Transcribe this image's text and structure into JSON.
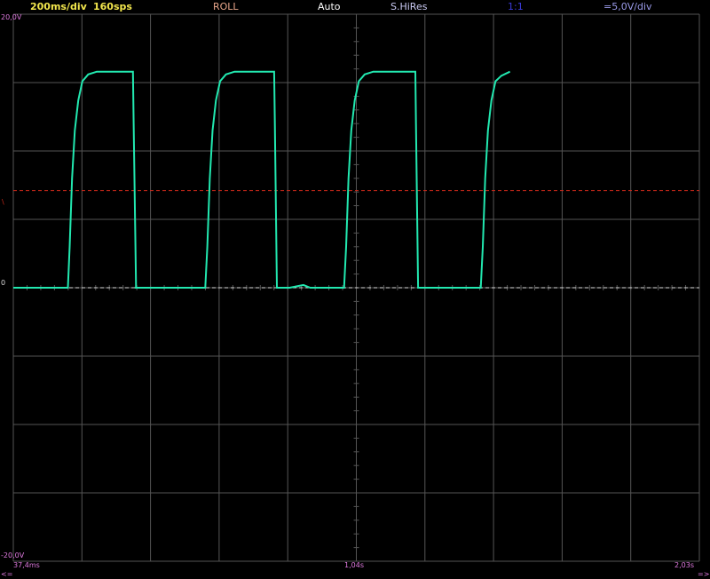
{
  "status": {
    "timebase": "200ms/div",
    "sample_rate": "160sps",
    "mode": "ROLL",
    "trigger": "Auto",
    "acquisition": "S.HiRes",
    "probe": "1:1",
    "volts_div": "=5,0V/div"
  },
  "colors": {
    "timebase": "#f2e64d",
    "mode": "#e8a68a",
    "trigger": "#ffffff",
    "acquisition": "#c9c9f2",
    "probe": "#3a3ad8",
    "volts_div": "#9a9ae8",
    "trace": "#22e8b0",
    "trigger_level_line": "#d02a1a",
    "ground_line": "#dcdcdc",
    "grid": "#555555",
    "axis_labels": "#e07ae0"
  },
  "axis_labels": {
    "y_top": "20,0V",
    "y_bottom": "-20,0V",
    "ground_marker": "0",
    "trigger_marker": "\\",
    "x_left": "37,4ms",
    "x_mid": "1,04s",
    "x_right": "2,03s",
    "left_arrow": "<=",
    "right_arrow": "=>"
  },
  "chart_data": {
    "type": "line",
    "x_unit": "s",
    "y_unit": "V",
    "xlim": [
      0.0374,
      2.03
    ],
    "ylim": [
      -20,
      20
    ],
    "grid": true,
    "divisions": {
      "x": 10,
      "y": 8
    },
    "trigger_level": 7.1,
    "ground_level": 0,
    "series": [
      {
        "points": [
          [
            0.0374,
            0
          ],
          [
            0.15,
            0
          ],
          [
            0.196,
            0
          ],
          [
            0.201,
            3.0
          ],
          [
            0.208,
            8.0
          ],
          [
            0.216,
            11.5
          ],
          [
            0.226,
            13.7
          ],
          [
            0.238,
            15.1
          ],
          [
            0.255,
            15.6
          ],
          [
            0.28,
            15.8
          ],
          [
            0.325,
            15.8
          ],
          [
            0.385,
            15.8
          ],
          [
            0.387,
            12.0
          ],
          [
            0.394,
            0
          ],
          [
            0.39,
            0
          ],
          [
            0.55,
            0
          ],
          [
            0.595,
            0
          ],
          [
            0.601,
            3.0
          ],
          [
            0.608,
            8.0
          ],
          [
            0.616,
            11.5
          ],
          [
            0.626,
            13.7
          ],
          [
            0.638,
            15.1
          ],
          [
            0.655,
            15.6
          ],
          [
            0.68,
            15.8
          ],
          [
            0.795,
            15.8
          ],
          [
            0.797,
            12.0
          ],
          [
            0.803,
            0
          ],
          [
            0.84,
            0
          ],
          [
            0.88,
            0.2
          ],
          [
            0.9,
            0
          ],
          [
            0.95,
            0
          ],
          [
            0.998,
            0
          ],
          [
            1.004,
            3.0
          ],
          [
            1.011,
            8.0
          ],
          [
            1.019,
            11.5
          ],
          [
            1.029,
            13.7
          ],
          [
            1.041,
            15.1
          ],
          [
            1.058,
            15.6
          ],
          [
            1.083,
            15.8
          ],
          [
            1.2,
            15.8
          ],
          [
            1.205,
            15.8
          ],
          [
            1.207,
            12.0
          ],
          [
            1.213,
            0
          ],
          [
            1.3,
            0
          ],
          [
            1.37,
            0
          ],
          [
            1.395,
            0
          ],
          [
            1.401,
            3.0
          ],
          [
            1.408,
            8.0
          ],
          [
            1.416,
            11.5
          ],
          [
            1.426,
            13.7
          ],
          [
            1.438,
            15.1
          ],
          [
            1.455,
            15.5
          ],
          [
            1.48,
            15.8
          ]
        ]
      }
    ]
  }
}
